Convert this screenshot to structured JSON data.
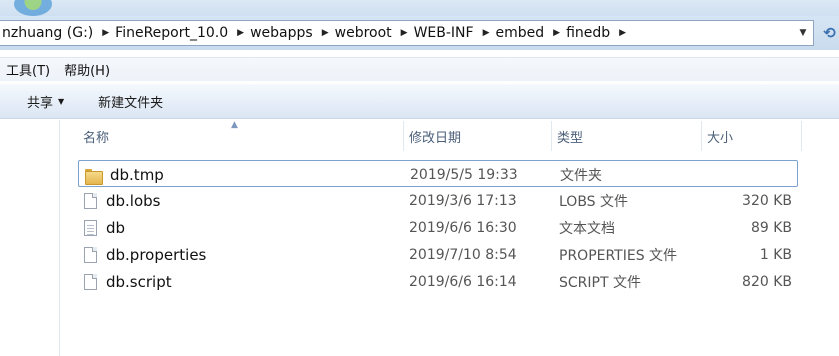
{
  "address": {
    "crumbs": [
      "nzhuang (G:)",
      "FineReport_10.0",
      "webapps",
      "webroot",
      "WEB-INF",
      "embed",
      "finedb"
    ]
  },
  "menu": {
    "items": [
      "工具(T)",
      "帮助(H)"
    ]
  },
  "toolbar": {
    "share_label": "共享",
    "new_folder_label": "新建文件夹"
  },
  "columns": {
    "name": "名称",
    "date": "修改日期",
    "type": "类型",
    "size": "大小"
  },
  "files": [
    {
      "name": "db.tmp",
      "date": "2019/5/5 19:33",
      "type": "文件夹",
      "size": "",
      "icon": "folder-icon"
    },
    {
      "name": "db.lobs",
      "date": "2019/3/6 17:13",
      "type": "LOBS 文件",
      "size": "320 KB",
      "icon": "file-icon"
    },
    {
      "name": "db",
      "date": "2019/6/6 16:30",
      "type": "文本文档",
      "size": "89 KB",
      "icon": "text-file-icon"
    },
    {
      "name": "db.properties",
      "date": "2019/7/10 8:54",
      "type": "PROPERTIES 文件",
      "size": "1 KB",
      "icon": "file-icon"
    },
    {
      "name": "db.script",
      "date": "2019/6/6 16:14",
      "type": "SCRIPT 文件",
      "size": "820 KB",
      "icon": "file-icon"
    }
  ]
}
